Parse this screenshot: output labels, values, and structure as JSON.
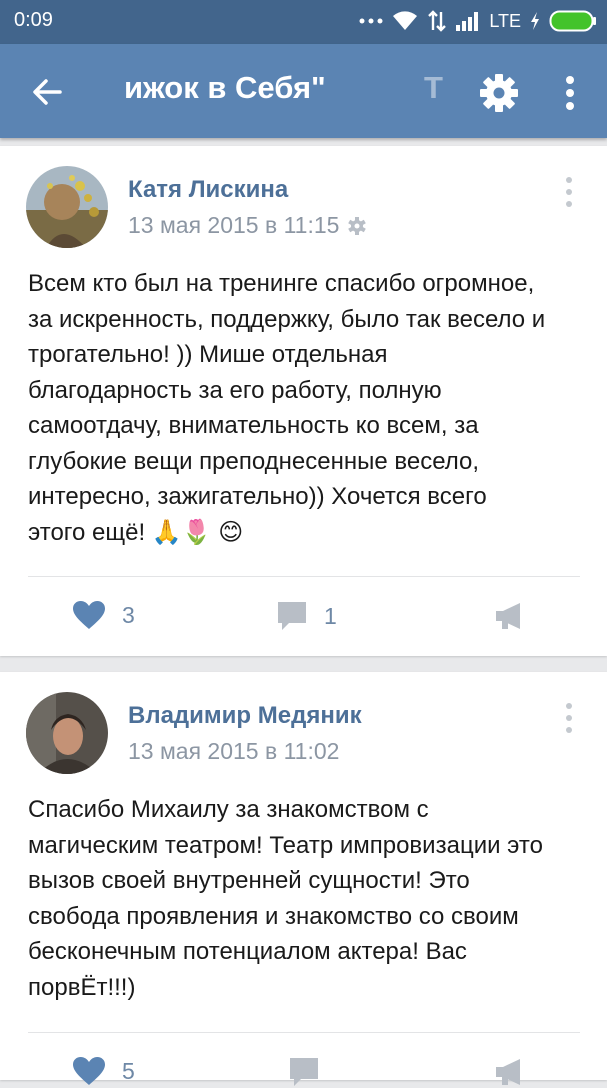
{
  "status_bar": {
    "time": "0:09",
    "network": "LTE",
    "icons": [
      "dots-icon",
      "wifi-icon",
      "data-transfer-icon",
      "signal-icon",
      "charging-icon",
      "battery-icon"
    ]
  },
  "app_bar": {
    "title": "ижок в Себя\"",
    "title_ghost": "Т",
    "icons": [
      "back-arrow-icon",
      "gear-icon",
      "more-vertical-icon"
    ]
  },
  "posts": [
    {
      "author": "Катя Лискина",
      "date": "13 мая 2015 в 11:15",
      "lines": [
        "Всем кто был на тренинге спасибо огромное,",
        "за искренность, поддержку, было так весело и",
        "трогательно! )) Мише отдельная",
        "благодарность за его работу, полную",
        "самоотдачу,  внимательность ко всем, за",
        "глубокие вещи преподнесенные весело,",
        "интересно, зажигательно)) Хочется всего",
        "этого ещё!"
      ],
      "emoji": [
        "🙏",
        "🌷",
        "😊"
      ],
      "likes": "3",
      "comments": "1"
    },
    {
      "author": "Владимир Медяник",
      "date": "13 мая 2015 в 11:02",
      "lines": [
        "Спасибо Михаилу за знакомством с",
        "магическим театром! Театр импровизации это",
        "вызов своей внутренней сущности! Это",
        "свобода проявления и знакомство со своим",
        "бесконечным потенциалом актера! Вас",
        "порвЁт!!!)"
      ],
      "likes": "5"
    }
  ],
  "colors": {
    "status_bar": "#42658c",
    "app_bar": "#5b84b3",
    "accent": "#4d7098",
    "like": "#5b84b3",
    "muted": "#b8bec6",
    "background": "#e8e9eb"
  }
}
